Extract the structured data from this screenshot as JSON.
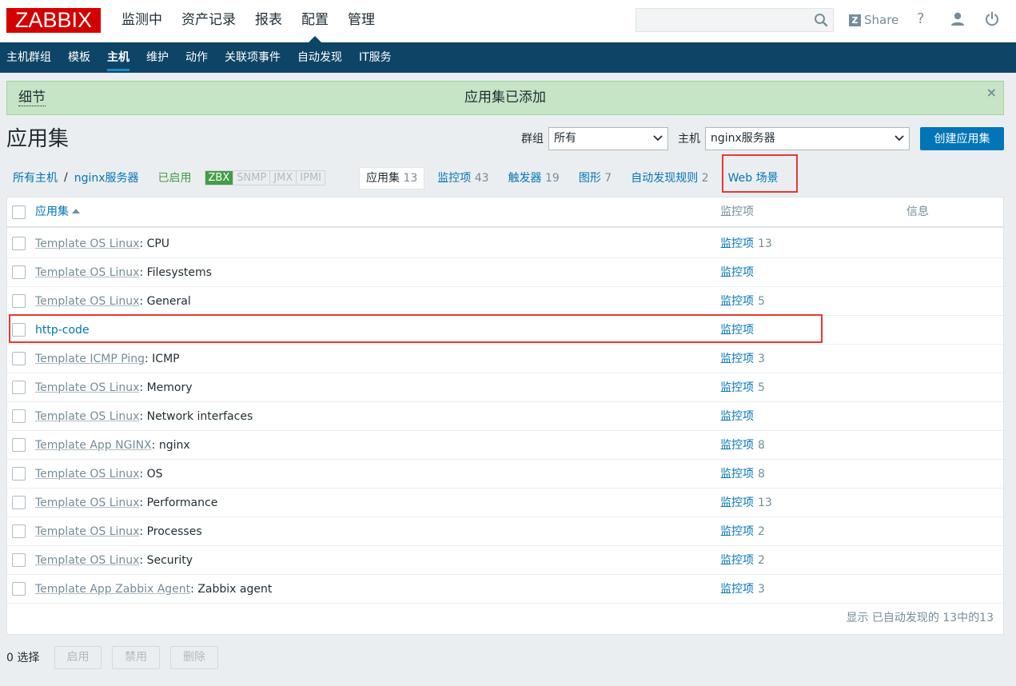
{
  "header": {
    "logo": "ZABBIX",
    "menu": [
      "监测中",
      "资产记录",
      "报表",
      "配置",
      "管理"
    ],
    "active_menu": "配置",
    "share": "Share",
    "help": "?"
  },
  "subnav": {
    "items": [
      "主机群组",
      "模板",
      "主机",
      "维护",
      "动作",
      "关联项事件",
      "自动发现",
      "IT服务"
    ],
    "active": "主机"
  },
  "message": {
    "detail": "细节",
    "text": "应用集已添加",
    "close": "×"
  },
  "page": {
    "title": "应用集",
    "group_label": "群组",
    "group_value": "所有",
    "host_label": "主机",
    "host_value": "nginx服务器",
    "create_button": "创建应用集"
  },
  "breadcrumb": {
    "all_hosts": "所有主机",
    "separator": "/",
    "host": "nginx服务器",
    "status": "已启用",
    "availability": [
      "ZBX",
      "SNMP",
      "JMX",
      "IPMI"
    ]
  },
  "tabs": [
    {
      "label": "应用集",
      "count": "13"
    },
    {
      "label": "监控项",
      "count": "43"
    },
    {
      "label": "触发器",
      "count": "19"
    },
    {
      "label": "图形",
      "count": "7"
    },
    {
      "label": "自动发现规则",
      "count": "2"
    },
    {
      "label": "Web 场景",
      "count": ""
    }
  ],
  "table": {
    "columns": [
      "应用集",
      "监控项",
      "信息"
    ],
    "rows": [
      {
        "template": "Template OS Linux",
        "name": "CPU",
        "items_label": "监控项",
        "items_count": "13"
      },
      {
        "template": "Template OS Linux",
        "name": "Filesystems",
        "items_label": "监控项",
        "items_count": ""
      },
      {
        "template": "Template OS Linux",
        "name": "General",
        "items_label": "监控项",
        "items_count": "5"
      },
      {
        "template": "",
        "name": "http-code",
        "items_label": "监控项",
        "items_count": ""
      },
      {
        "template": "Template ICMP Ping",
        "name": "ICMP",
        "items_label": "监控项",
        "items_count": "3"
      },
      {
        "template": "Template OS Linux",
        "name": "Memory",
        "items_label": "监控项",
        "items_count": "5"
      },
      {
        "template": "Template OS Linux",
        "name": "Network interfaces",
        "items_label": "监控项",
        "items_count": ""
      },
      {
        "template": "Template App NGINX",
        "name": "nginx",
        "items_label": "监控项",
        "items_count": "8"
      },
      {
        "template": "Template OS Linux",
        "name": "OS",
        "items_label": "监控项",
        "items_count": "8"
      },
      {
        "template": "Template OS Linux",
        "name": "Performance",
        "items_label": "监控项",
        "items_count": "13"
      },
      {
        "template": "Template OS Linux",
        "name": "Processes",
        "items_label": "监控项",
        "items_count": "2"
      },
      {
        "template": "Template OS Linux",
        "name": "Security",
        "items_label": "监控项",
        "items_count": "2"
      },
      {
        "template": "Template App Zabbix Agent",
        "name": "Zabbix agent",
        "items_label": "监控项",
        "items_count": "3"
      }
    ],
    "footer": "显示 已自动发现的 13中的13"
  },
  "actions": {
    "selected": "0 选择",
    "buttons": [
      "启用",
      "禁用",
      "删除"
    ]
  },
  "colors": {
    "brand": "#d40000",
    "nav": "#0e4466",
    "link": "#0275b8",
    "success_bg": "#c5e5c6",
    "highlight": "#e53935"
  }
}
